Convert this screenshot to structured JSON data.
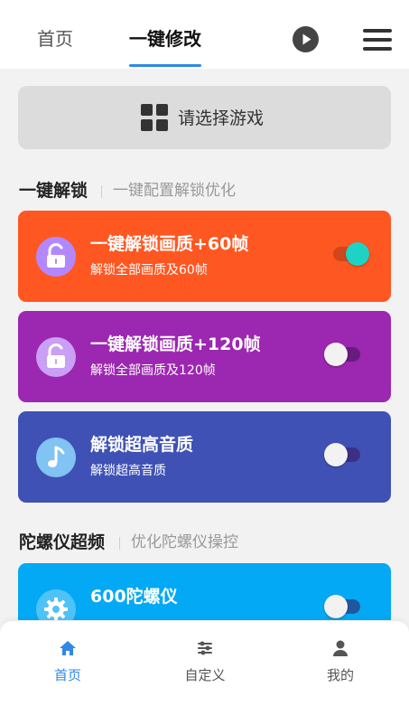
{
  "header": {
    "tabs": [
      {
        "label": "首页",
        "active": false
      },
      {
        "label": "一键修改",
        "active": true
      }
    ],
    "accent_color": "#2f89e5",
    "icons": [
      "play-icon",
      "menu-icon"
    ]
  },
  "game_select": {
    "label": "请选择游戏",
    "icon": "grid-icon"
  },
  "sections": [
    {
      "title": "一键解锁",
      "subtitle": "一键配置解锁优化",
      "cards": [
        {
          "title": "一键解锁画质+60帧",
          "desc": "解锁全部画质及60帧",
          "icon": "unlock-icon",
          "color": "#ff5722",
          "enabled": true
        },
        {
          "title": "一键解锁画质+120帧",
          "desc": "解锁全部画质及120帧",
          "icon": "unlock-icon",
          "color": "#9c27b0",
          "enabled": false
        },
        {
          "title": "解锁超高音质",
          "desc": "解锁超高音质",
          "icon": "music-note-icon",
          "color": "#3f51b5",
          "enabled": false
        }
      ]
    },
    {
      "title": "陀螺仪超频",
      "subtitle": "优化陀螺仪操控",
      "cards": [
        {
          "title": "600陀螺仪",
          "desc": "",
          "icon": "gear-icon",
          "color": "#03a9f4",
          "enabled": false
        }
      ]
    }
  ],
  "bottom_nav": {
    "items": [
      {
        "label": "首页",
        "icon": "home-icon",
        "active": true
      },
      {
        "label": "自定义",
        "icon": "sliders-icon",
        "active": false
      },
      {
        "label": "我的",
        "icon": "user-icon",
        "active": false
      }
    ],
    "active_color": "#2f89e5",
    "inactive_color": "#555555"
  }
}
